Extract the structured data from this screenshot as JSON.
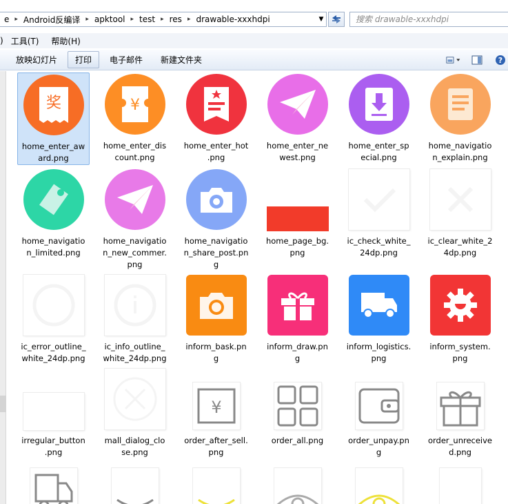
{
  "address": {
    "crumbs": [
      "e",
      "Android反编译",
      "apktool",
      "test",
      "res",
      "drawable-xxxhdpi"
    ],
    "search_placeholder": "搜索 drawable-xxxhdpi"
  },
  "menu": [
    "工具(T)",
    "帮助(H)"
  ],
  "menu_left": ")",
  "toolbar": [
    "放映幻灯片",
    "打印",
    "电子邮件",
    "新建文件夹"
  ],
  "icons": {
    "view": "view-options-icon",
    "pane": "preview-pane-icon",
    "help": "help-icon"
  },
  "files": [
    {
      "name": "home_enter_award.png",
      "line1": "home_enter_aw",
      "line2": "ard.png",
      "color": "#f76d25",
      "glyph": "奖"
    },
    {
      "name": "home_enter_discount.png",
      "line1": "home_enter_dis",
      "line2": "count.png",
      "color": "#fd8e25",
      "glyph": "¥"
    },
    {
      "name": "home_enter_hot.png",
      "line1": "home_enter_hot",
      "line2": ".png",
      "color": "#f0333e",
      "glyph": ""
    },
    {
      "name": "home_enter_newest.png",
      "line1": "home_enter_ne",
      "line2": "west.png",
      "color": "#e86ee8",
      "glyph": ""
    },
    {
      "name": "home_enter_special.png",
      "line1": "home_enter_sp",
      "line2": "ecial.png",
      "color": "#ab5ef0",
      "glyph": ""
    },
    {
      "name": "home_navigation_explain.png",
      "line1": "home_navigatio",
      "line2": "n_explain.png",
      "color": "#f9a55e",
      "glyph": ""
    },
    {
      "name": "home_navigation_limited.png",
      "line1": "home_navigatio",
      "line2": "n_limited.png",
      "color": "#2dd6a6",
      "glyph": ""
    },
    {
      "name": "home_navigation_new_commer.png",
      "line1": "home_navigatio",
      "line2": "n_new_commer.",
      "line3": "png",
      "color": "#e87ae8",
      "glyph": ""
    },
    {
      "name": "home_navigation_share_post.png",
      "line1": "home_navigatio",
      "line2": "n_share_post.pn",
      "line3": "g",
      "color": "#85a7f7",
      "glyph": ""
    },
    {
      "name": "home_page_bg.png",
      "line1": "home_page_bg.",
      "line2": "png",
      "color": "#f23b2a",
      "glyph": ""
    },
    {
      "name": "ic_check_white_24dp.png",
      "line1": "ic_check_white_",
      "line2": "24dp.png",
      "color": "#ffffff",
      "glyph": ""
    },
    {
      "name": "ic_clear_white_24dp.png",
      "line1": "ic_clear_white_2",
      "line2": "4dp.png",
      "color": "#ffffff",
      "glyph": ""
    },
    {
      "name": "ic_error_outline_white_24dp.png",
      "line1": "ic_error_outline_",
      "line2": "white_24dp.png",
      "color": "#ffffff",
      "glyph": ""
    },
    {
      "name": "ic_info_outline_white_24dp.png",
      "line1": "ic_info_outline_",
      "line2": "white_24dp.png",
      "color": "#ffffff",
      "glyph": ""
    },
    {
      "name": "inform_bask.png",
      "line1": "inform_bask.pn",
      "line2": "g",
      "color": "#f98b12",
      "glyph": ""
    },
    {
      "name": "inform_draw.png",
      "line1": "inform_draw.pn",
      "line2": "g",
      "color": "#f72f79",
      "glyph": ""
    },
    {
      "name": "inform_logistics.png",
      "line1": "inform_logistics.",
      "line2": "png",
      "color": "#2f8af7",
      "glyph": ""
    },
    {
      "name": "inform_system.png",
      "line1": "inform_system.",
      "line2": "png",
      "color": "#f23535",
      "glyph": ""
    },
    {
      "name": "irregular_button.png",
      "line1": "irregular_button",
      "line2": ".png",
      "color": "#ffffff",
      "glyph": ""
    },
    {
      "name": "mall_dialog_close.png",
      "line1": "mall_dialog_clo",
      "line2": "se.png",
      "color": "#ffffff",
      "glyph": ""
    },
    {
      "name": "order_after_sell.png",
      "line1": "order_after_sell.",
      "line2": "png",
      "color": "#888888",
      "glyph": "¥"
    },
    {
      "name": "order_all.png",
      "line1": "order_all.png",
      "line2": "",
      "color": "#888888",
      "glyph": ""
    },
    {
      "name": "order_unpay.png",
      "line1": "order_unpay.pn",
      "line2": "g",
      "color": "#888888",
      "glyph": ""
    },
    {
      "name": "order_unreceived.png",
      "line1": "order_unreceive",
      "line2": "d.png",
      "color": "#888888",
      "glyph": ""
    }
  ]
}
